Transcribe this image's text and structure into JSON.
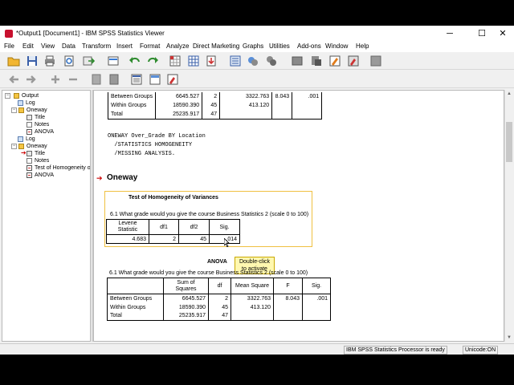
{
  "window": {
    "title": "*Output1 [Document1] - IBM SPSS Statistics Viewer",
    "controls": {
      "minimize": "─",
      "maximize": "☐",
      "close": "✕"
    }
  },
  "menu": [
    "File",
    "Edit",
    "View",
    "Data",
    "Transform",
    "Insert",
    "Format",
    "Analyze",
    "Direct Marketing",
    "Graphs",
    "Utilities",
    "Add-ons",
    "Window",
    "Help"
  ],
  "toolbar1_icons": [
    "open-icon",
    "save-icon",
    "print-icon",
    "print-preview-icon",
    "export-icon",
    "recall-dialog-icon",
    "undo-icon",
    "redo-icon",
    "goto-data-icon",
    "goto-case-icon",
    "goto-variable-icon",
    "variables-icon",
    "chart-builder-icon",
    "bubble-icon",
    "designate-window-icon",
    "select-output-icon",
    "insert-text-icon",
    "create-title-icon",
    "stop-icon"
  ],
  "toolbar2_icons": [
    "back-icon",
    "forward-icon",
    "expand-icon",
    "collapse-icon",
    "show-icon",
    "hide-icon",
    "insert-heading-icon",
    "insert-new-title-icon",
    "insert-new-text-icon"
  ],
  "outline": {
    "items": [
      {
        "label": "Output",
        "icon": "book",
        "expand": "−"
      },
      {
        "label": "Log",
        "icon": "log"
      },
      {
        "label": "Oneway",
        "icon": "book",
        "expand": "−"
      },
      {
        "label": "Title",
        "icon": "title"
      },
      {
        "label": "Notes",
        "icon": "doc"
      },
      {
        "label": "ANOVA",
        "icon": "table"
      },
      {
        "label": "Log",
        "icon": "log"
      },
      {
        "label": "Oneway",
        "icon": "book",
        "expand": "−"
      },
      {
        "label": "Title",
        "icon": "title"
      },
      {
        "label": "Notes",
        "icon": "doc"
      },
      {
        "label": "Test of Homogeneity of Variances",
        "icon": "table"
      },
      {
        "label": "ANOVA",
        "icon": "table"
      }
    ]
  },
  "top_anova": {
    "rows": [
      [
        "Between Groups",
        "6645.527",
        "2",
        "3322.763",
        "8.043",
        ".001"
      ],
      [
        "Within Groups",
        "18590.390",
        "45",
        "413.120",
        "",
        ""
      ],
      [
        "Total",
        "25235.917",
        "47",
        "",
        "",
        ""
      ]
    ]
  },
  "syntax": {
    "line1": "ONEWAY Over_Grade BY Location",
    "line2": "  /STATISTICS HOMOGENEITY",
    "line3": "  /MISSING ANALYSIS."
  },
  "oneway_heading": "Oneway",
  "homogeneity": {
    "title": "Test of Homogeneity of Variances",
    "subtitle": "6.1 What grade would you give the course Business Statistics 2 (scale 0 to 100)",
    "headers": [
      "Levene Statistic",
      "df1",
      "df2",
      "Sig."
    ],
    "values": [
      "4.683",
      "2",
      "45",
      ".014"
    ]
  },
  "tooltip": "Double-click to activate",
  "anova": {
    "title": "ANOVA",
    "subtitle": "6.1 What grade would you give the course Business Statistics 2 (scale 0 to 100)",
    "headers": [
      "",
      "Sum of Squares",
      "df",
      "Mean Square",
      "F",
      "Sig."
    ],
    "rows": [
      [
        "Between Groups",
        "6645.527",
        "2",
        "3322.763",
        "8.043",
        ".001"
      ],
      [
        "Within Groups",
        "18590.390",
        "45",
        "413.120",
        "",
        ""
      ],
      [
        "Total",
        "25235.917",
        "47",
        "",
        "",
        ""
      ]
    ]
  },
  "status": {
    "processor": "IBM SPSS Statistics Processor is ready",
    "unicode": "Unicode:ON"
  }
}
